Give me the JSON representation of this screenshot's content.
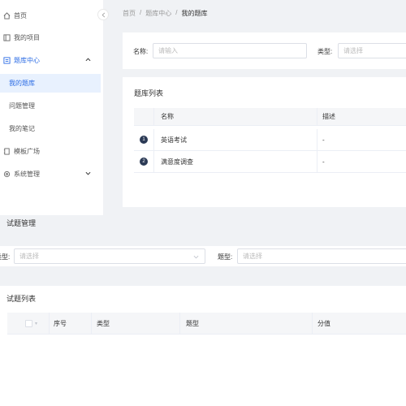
{
  "sidebar": {
    "items": [
      {
        "label": "首页",
        "icon": "home-icon"
      },
      {
        "label": "我的项目",
        "icon": "project-icon"
      },
      {
        "label": "题库中心",
        "icon": "list-icon"
      },
      {
        "label": "模板广场",
        "icon": "template-icon"
      },
      {
        "label": "系统管理",
        "icon": "gear-icon"
      }
    ],
    "subitems": [
      {
        "label": "我的题库"
      },
      {
        "label": "问题管理"
      },
      {
        "label": "我的笔记"
      }
    ]
  },
  "breadcrumb": {
    "home": "首页",
    "sep": "/",
    "center": "题库中心",
    "current": "我的题库"
  },
  "search": {
    "name_label": "名称:",
    "name_placeholder": "请输入",
    "type_label": "类型:",
    "type_placeholder": "请选择"
  },
  "library": {
    "title": "题库列表",
    "columns": [
      "名称",
      "描述"
    ],
    "rows": [
      {
        "index": "1",
        "name": "英语考试",
        "desc": "-"
      },
      {
        "index": "2",
        "name": "满意度调查",
        "desc": "-"
      }
    ]
  },
  "questions": {
    "title": "试题管理",
    "filter": {
      "type_label": "类型:",
      "type_placeholder": "请选择",
      "qtype_label": "题型:",
      "qtype_placeholder": "请选择"
    },
    "list_title": "试题列表",
    "columns": [
      "序号",
      "类型",
      "题型",
      "分值"
    ]
  },
  "colors": {
    "accent": "#2d6de5",
    "active_bg": "#e8f1fe",
    "page_bg": "#f0f2f5",
    "dot": "#2b3a55"
  }
}
